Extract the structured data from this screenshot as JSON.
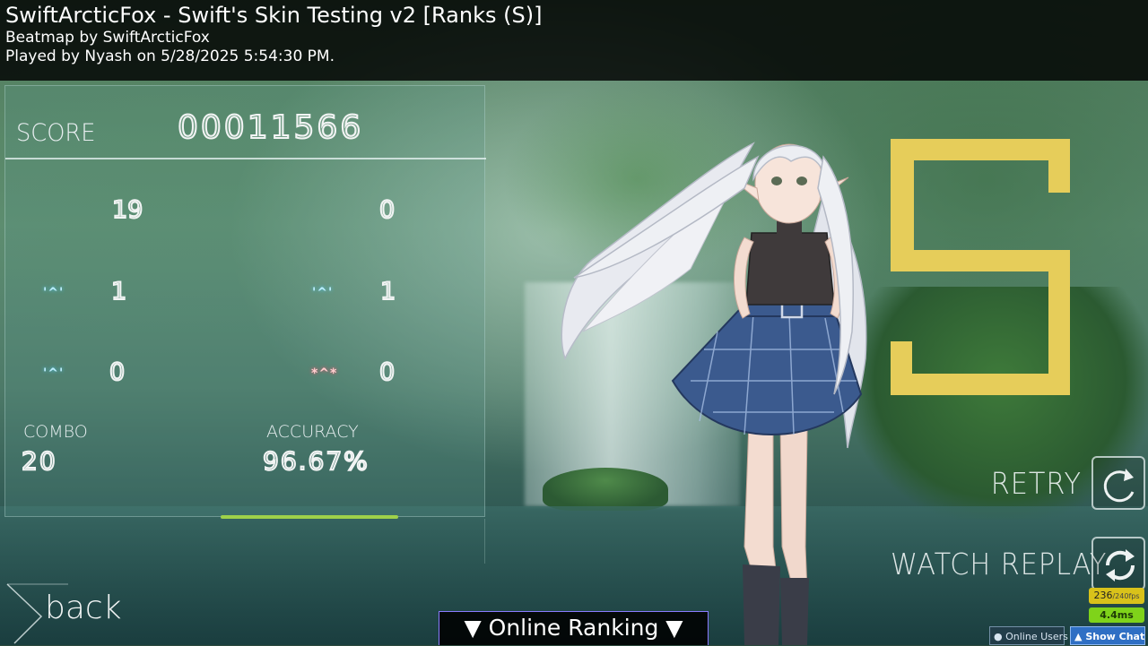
{
  "header": {
    "title": "SwiftArcticFox - Swift's Skin Testing v2 [Ranks (S)]",
    "beatmap_by": "Beatmap by SwiftArcticFox",
    "played_by": "Played by Nyash on 5/28/2025 5:54:30 PM."
  },
  "score": {
    "label": "SCORE",
    "value": "00011566"
  },
  "hits": {
    "count_300": "19",
    "count_geki": "0",
    "count_100": "1",
    "count_katu": "1",
    "count_50": "0",
    "count_miss": "0",
    "icon_text": "'^'",
    "miss_icon_text": "*^*"
  },
  "combo": {
    "label": "COMBO",
    "value": "20"
  },
  "accuracy": {
    "label": "ACCURACY",
    "value": "96.67%"
  },
  "rank": {
    "grade": "S",
    "color": "#e6cd5a"
  },
  "buttons": {
    "retry": "RETRY",
    "watch_replay": "WATCH REPLAY",
    "back": "back"
  },
  "online_ranking": "▼ Online Ranking ▼",
  "perf": {
    "fps": "236",
    "fps_target": "/240fps",
    "latency": "4.4ms"
  },
  "chat": {
    "online_users": "Online Users",
    "show_chat": "Show Chat"
  }
}
